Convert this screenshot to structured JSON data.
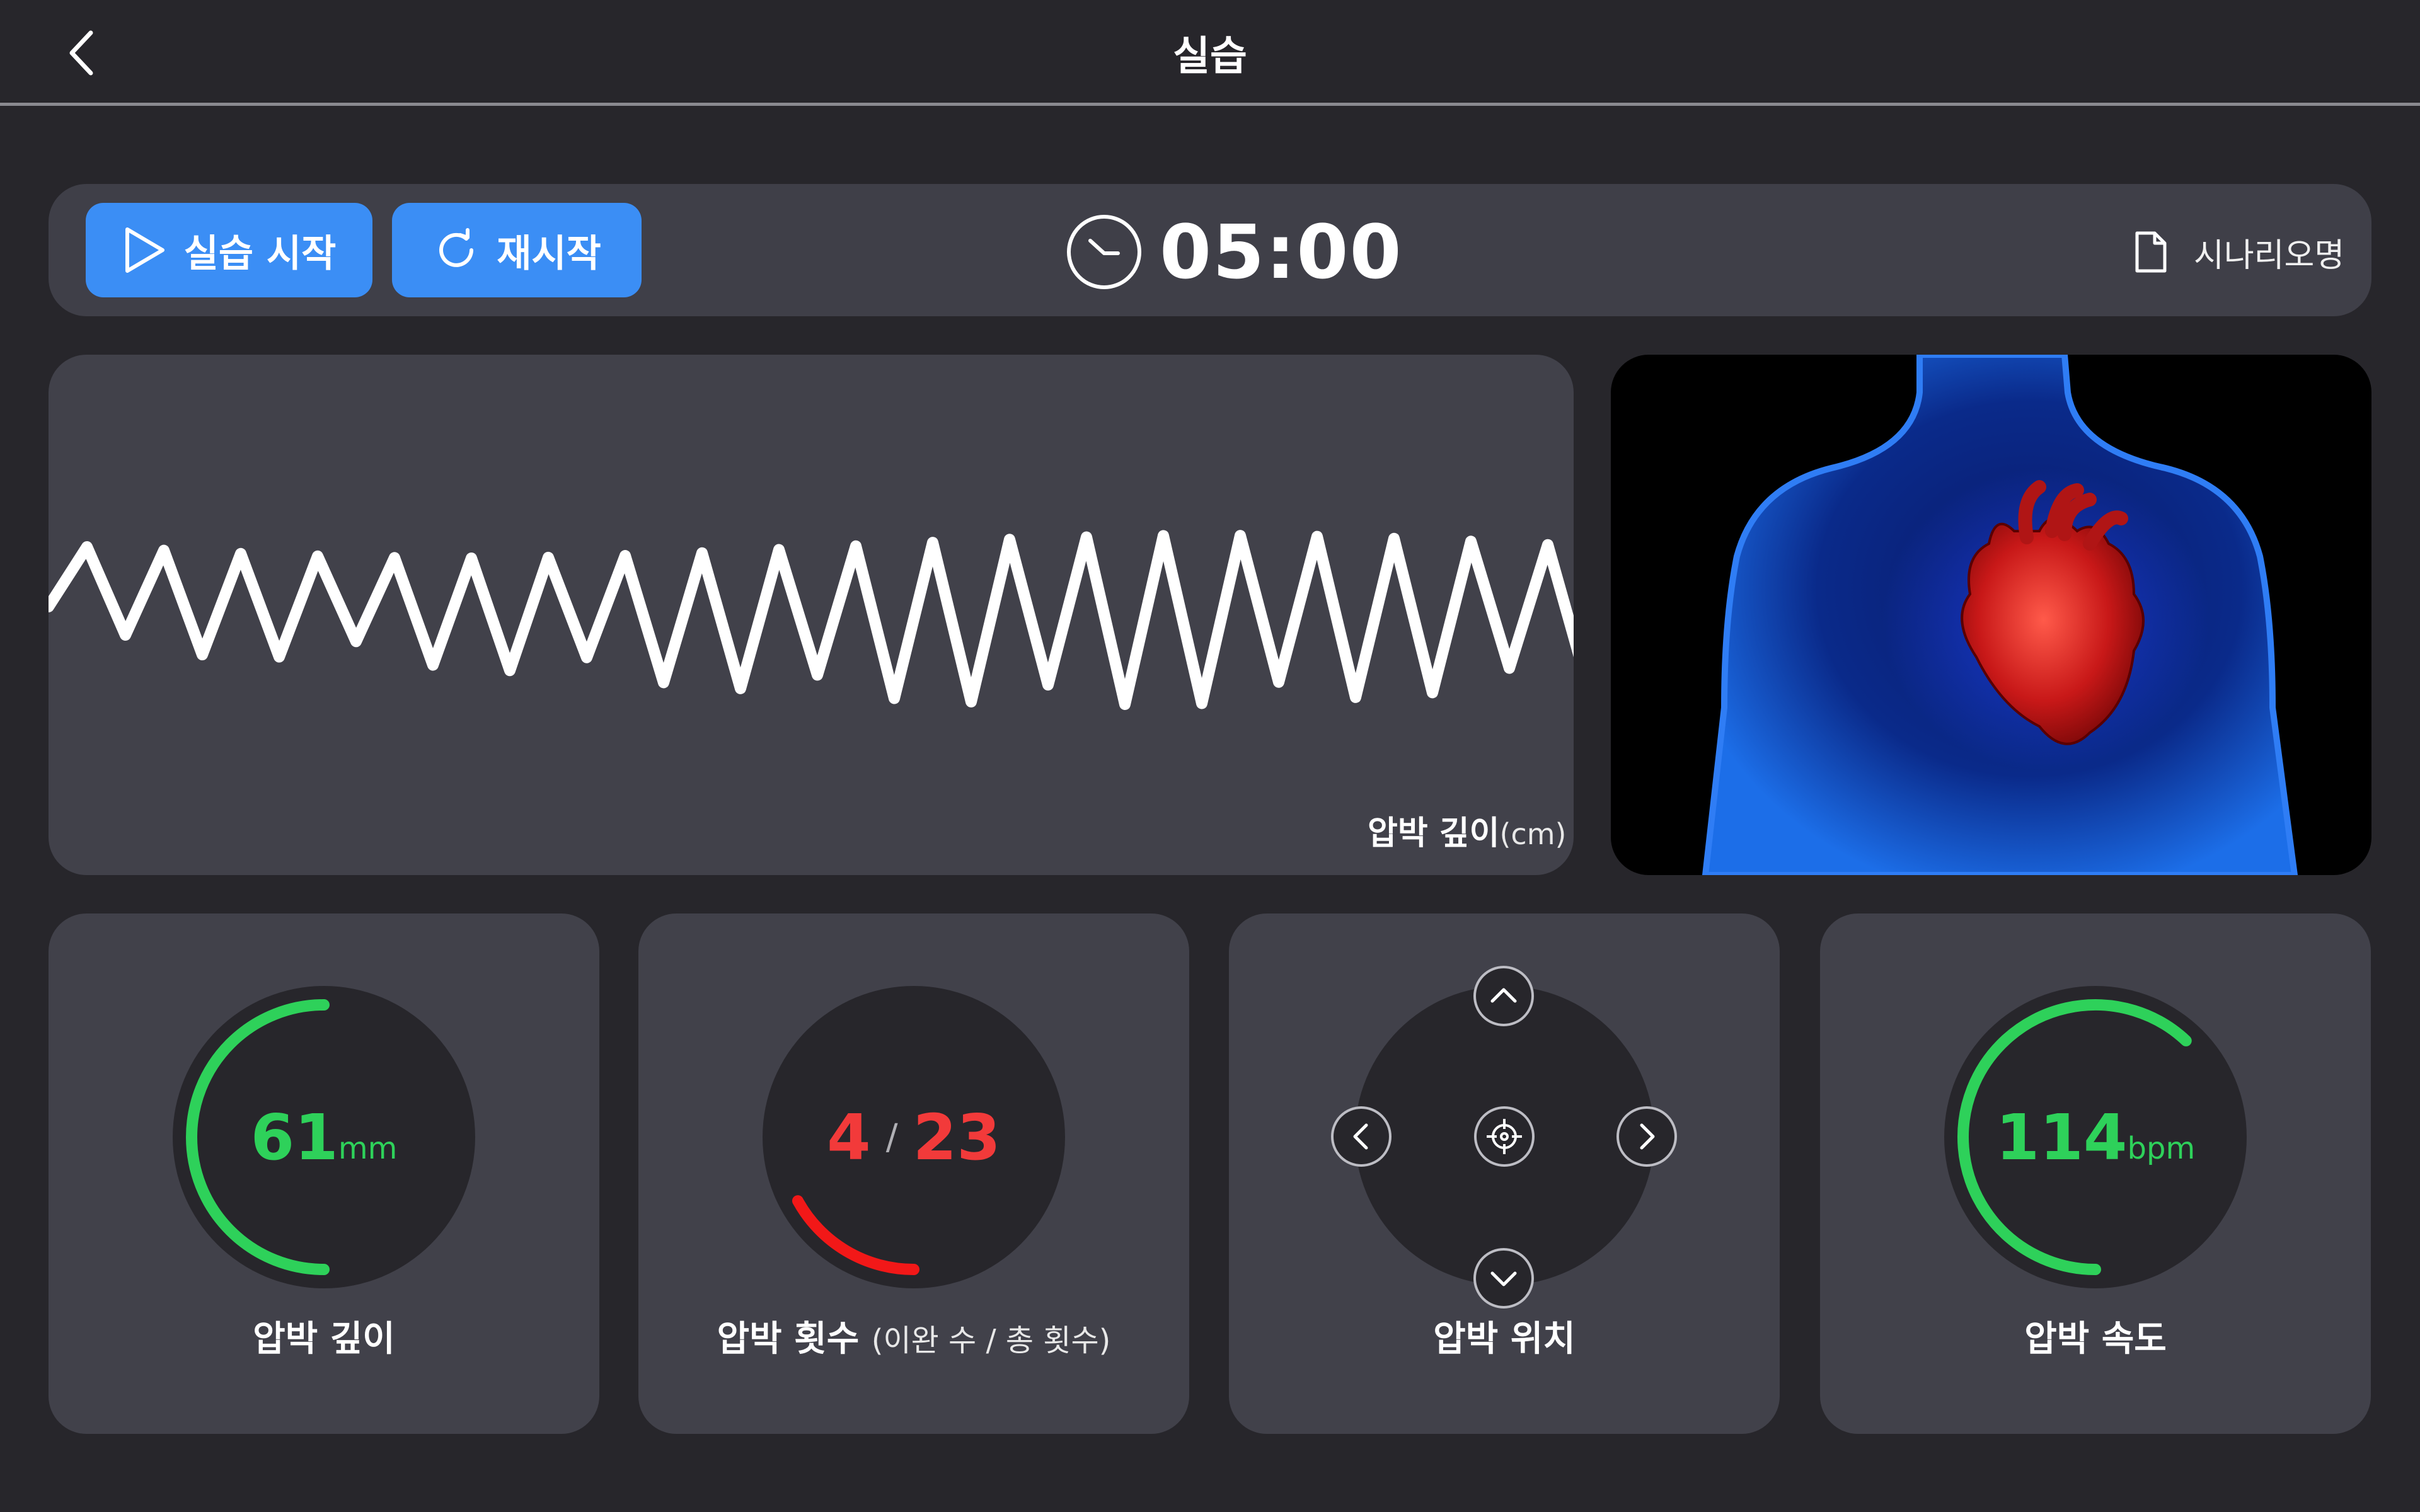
{
  "header": {
    "title": "실습",
    "back_icon": "chevron-left-icon"
  },
  "controls": {
    "start_label": "실습 시작",
    "start_icon": "play-icon",
    "restart_label": "재시작",
    "restart_icon": "refresh-icon",
    "timer": "05:00",
    "timer_icon": "clock-icon",
    "scenario_label": "시나리오명",
    "scenario_icon": "document-icon"
  },
  "waveform": {
    "label": "압박 깊이",
    "unit": "(cm)"
  },
  "cards": {
    "depth": {
      "value": "61",
      "unit": "mm",
      "label": "압박 깊이",
      "color": "#2ed15a",
      "gauge_fraction": 0.5
    },
    "count": {
      "current": "4",
      "separator": "/",
      "total": "23",
      "label": "압박 횟수",
      "sublabel": "(이완 수 / 총 횟수)",
      "color": "#f23a3a",
      "gauge_fraction": 0.17
    },
    "position": {
      "label": "압박 위치",
      "icons": [
        "chevron-up-icon",
        "chevron-left-icon",
        "crosshair-icon",
        "chevron-right-icon",
        "chevron-down-icon"
      ]
    },
    "speed": {
      "value": "114",
      "unit": "bpm",
      "label": "압박 속도",
      "color": "#2ed15a",
      "gauge_fraction": 0.62
    }
  },
  "colors": {
    "accent_blue": "#3b8ef5",
    "background": "#27262b",
    "panel": "#41414a",
    "good": "#2ed15a",
    "bad": "#f23a3a"
  }
}
